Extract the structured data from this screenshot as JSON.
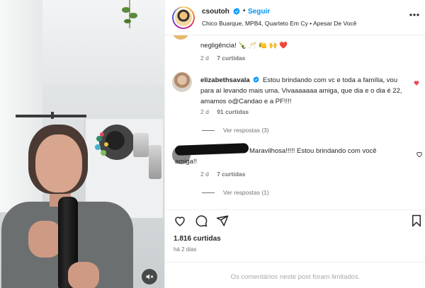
{
  "post": {
    "author": "csoutoh",
    "follow_label": "Seguir",
    "separator": "•",
    "music": "Chico Buarque, MPB4, Quarteto Em Cy • Apesar De Você"
  },
  "comments": {
    "partial": {
      "text_line1": "",
      "text_line2": "negligência! 🍾 🥂 🍋 🙌 ❤️",
      "age": "2 d",
      "likes": "7 curtidas"
    },
    "items": [
      {
        "username": "elizabethsavala",
        "text": "Estou brindando com vc e toda a família, vou para aí levando mais uma. Vivaaaaaaa amiga, que dia e o dia é 22, amamos o@Candao e a PF!!!!",
        "age": "2 d",
        "likes": "91 curtidas",
        "replies": "Ver respostas (3)",
        "liked": true
      },
      {
        "username": "",
        "text": "Maravilhosa!!!!! Estou brindando com você amiga!!",
        "age": "2 d",
        "likes": "7 curtidas",
        "replies": "Ver respostas (1)",
        "liked": false
      }
    ]
  },
  "stats": {
    "likes": "1.816 curtidas",
    "date": "há 2 dias"
  },
  "footer": {
    "limited_text": "Os comentários neste post foram limitados."
  },
  "colors": {
    "link_blue": "#0095f6",
    "like_red": "#ed4956",
    "muted": "#737373"
  },
  "icons": {
    "verified": "verified-badge-icon",
    "more": "more-options-icon",
    "heart": "heart-icon",
    "comment": "comment-icon",
    "share": "share-icon",
    "bookmark": "bookmark-icon",
    "mute": "audio-muted-icon"
  }
}
